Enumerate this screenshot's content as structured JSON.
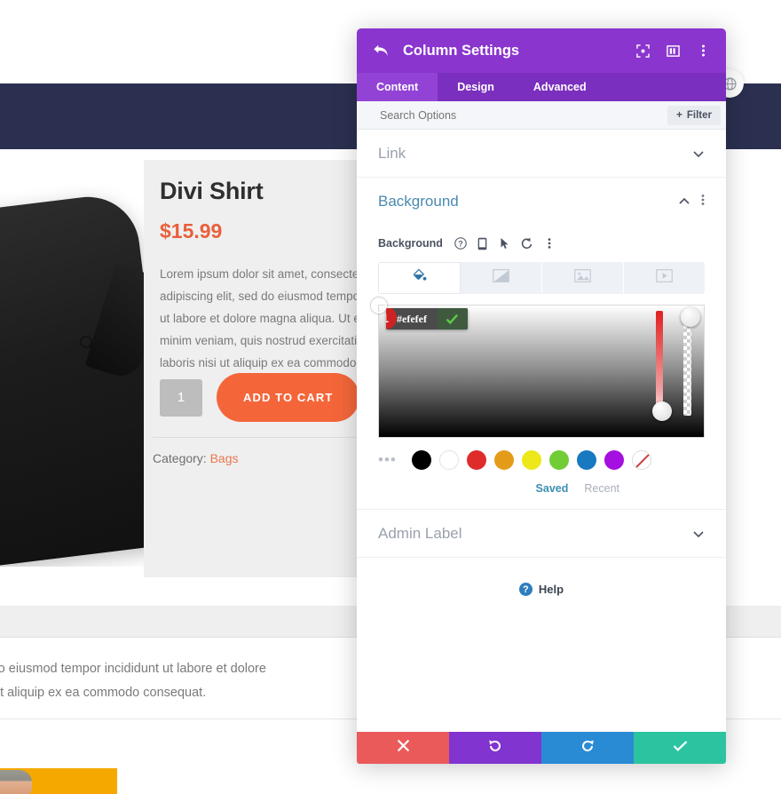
{
  "site": {
    "product": {
      "title": "Divi Shirt",
      "price": "$15.99",
      "description": "Lorem ipsum dolor sit amet, consectetur adipiscing elit, sed do eiusmod tempor incididunt ut labore et dolore magna aliqua. Ut enim ad minim veniam, quis nostrud exercitation ullamco laboris nisi ut aliquip ex ea commodo consequat.",
      "quantity": "1",
      "add_to_cart_label": "ADD TO CART",
      "category_label": "Category:",
      "category_value": "Bags",
      "zoom_icon": "magnifier-icon"
    },
    "tab_panel_text": "lipiscing elit, sed do eiusmod tempor incididunt ut labore et dolore\namco laboris nisi ut aliquip ex ea commodo consequat.",
    "globe_icon": "globe-icon",
    "annotation_arrow": "red-up-arrow"
  },
  "modal": {
    "title": "Column Settings",
    "back_icon": "back-arrow-icon",
    "header_icons": [
      "fullscreen-icon",
      "layout-columns-icon",
      "kebab-menu-icon"
    ],
    "tabs": [
      {
        "label": "Content",
        "active": true
      },
      {
        "label": "Design",
        "active": false
      },
      {
        "label": "Advanced",
        "active": false
      }
    ],
    "search": {
      "placeholder": "Search Options",
      "value": "",
      "filter_label": "Filter",
      "filter_icon": "plus-icon"
    },
    "sections": [
      {
        "name": "link",
        "title": "Link",
        "state": "collapsed",
        "chevron": "chevron-down-icon"
      },
      {
        "name": "background",
        "title": "Background",
        "state": "expanded",
        "chevron": "chevron-up-icon",
        "kebab": "kebab-menu-icon"
      },
      {
        "name": "admin-label",
        "title": "Admin Label",
        "state": "collapsed",
        "chevron": "chevron-down-icon"
      }
    ],
    "background": {
      "field_label": "Background",
      "field_icons": [
        "help-icon",
        "responsive-mobile-icon",
        "hover-cursor-icon",
        "reset-icon",
        "kebab-menu-icon"
      ],
      "type_tabs": [
        {
          "name": "color",
          "icon": "paint-bucket-icon",
          "active": true
        },
        {
          "name": "gradient",
          "icon": "gradient-icon",
          "active": false
        },
        {
          "name": "image",
          "icon": "image-icon",
          "active": false
        },
        {
          "name": "video",
          "icon": "video-icon",
          "active": false
        }
      ],
      "picker": {
        "hex": "#efefef",
        "confirm_icon": "check-icon",
        "step_badge": "1",
        "hue_value": 0,
        "alpha_value": 100
      },
      "swatches": [
        {
          "name": "black",
          "color": "#000000"
        },
        {
          "name": "white",
          "color": "#ffffff"
        },
        {
          "name": "red",
          "color": "#e02b2b"
        },
        {
          "name": "orange",
          "color": "#e49b18"
        },
        {
          "name": "yellow",
          "color": "#ece81a"
        },
        {
          "name": "green",
          "color": "#72cc36"
        },
        {
          "name": "blue",
          "color": "#1878c0"
        },
        {
          "name": "purple",
          "color": "#a50fe0"
        },
        {
          "name": "none",
          "color": "none"
        }
      ],
      "more_swatches_icon": "ellipsis-icon",
      "saved_label": "Saved",
      "recent_label": "Recent"
    },
    "help": {
      "label": "Help",
      "icon": "question-icon"
    },
    "footer": [
      {
        "name": "cancel",
        "icon": "close-x-icon",
        "color": "#eb5a5a"
      },
      {
        "name": "undo",
        "icon": "undo-icon",
        "color": "#8134cf"
      },
      {
        "name": "redo",
        "icon": "redo-icon",
        "color": "#2a8bd5"
      },
      {
        "name": "save",
        "icon": "check-icon",
        "color": "#2cc4a0"
      }
    ]
  },
  "colors": {
    "brand_purple": "#8A35CE",
    "tabbar_purple": "#7B2FBE",
    "accent_orange": "#f4663a",
    "navy": "#2b3050",
    "section_title_blue": "#4a8ab0"
  }
}
